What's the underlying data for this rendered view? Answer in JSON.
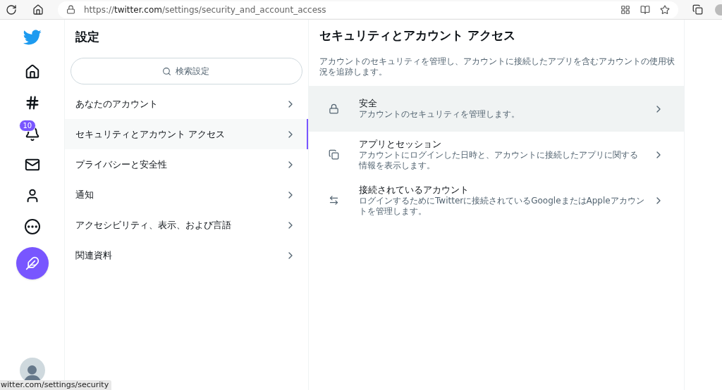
{
  "browser": {
    "url": "https://**twitter.com**/settings/security_and_account_access"
  },
  "nav": {
    "notification_badge": "10"
  },
  "settings": {
    "title": "設定",
    "search": {
      "placeholder": "検索設定"
    },
    "items": [
      {
        "label": "あなたのアカウント",
        "selected": false
      },
      {
        "label": "セキュリティとアカウント アクセス",
        "selected": true
      },
      {
        "label": "プライバシーと安全性",
        "selected": false
      },
      {
        "label": "通知",
        "selected": false
      },
      {
        "label": "アクセシビリティ、表示、および言語",
        "selected": false
      },
      {
        "label": "関連資料",
        "selected": false
      }
    ]
  },
  "detail": {
    "title": "セキュリティとアカウント アクセス",
    "description": "アカウントのセキュリティを管理し、アカウントに接続したアプリを含むアカウントの使用状況を追跡します。",
    "items": [
      {
        "title": "安全",
        "description": "アカウントのセキュリティを管理します。",
        "highlighted": true
      },
      {
        "title": "アプリとセッション",
        "description": "アカウントにログインした日時と、アカウントに接続したアプリに関する情報を表示します。",
        "highlighted": false
      },
      {
        "title": "接続されているアカウント",
        "description": "ログインするためにTwitterに接続されているGoogleまたはAppleアカウントを管理します。",
        "highlighted": false
      }
    ]
  },
  "status_url": "witter.com/settings/security"
}
